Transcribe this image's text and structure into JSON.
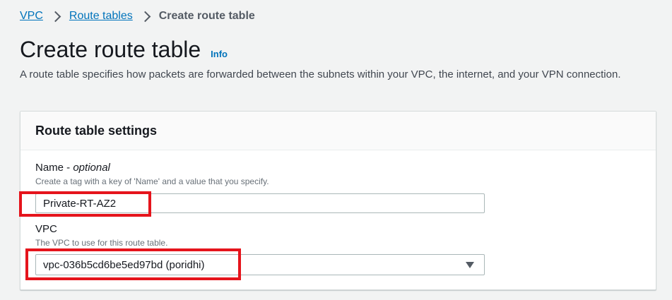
{
  "breadcrumb": {
    "items": [
      {
        "label": "VPC"
      },
      {
        "label": "Route tables"
      }
    ],
    "current": "Create route table"
  },
  "header": {
    "title": "Create route table",
    "info_label": "Info",
    "description": "A route table specifies how packets are forwarded between the subnets within your VPC, the internet, and your VPN connection."
  },
  "settings": {
    "title": "Route table settings",
    "name_field": {
      "label": "Name - ",
      "label_optional": "optional",
      "description": "Create a tag with a key of 'Name' and a value that you specify.",
      "value": "Private-RT-AZ2"
    },
    "vpc_field": {
      "label": "VPC",
      "description": "The VPC to use for this route table.",
      "selected": "vpc-036b5cd6be5ed97bd (poridhi)"
    }
  },
  "colors": {
    "link": "#0073bb",
    "highlight": "#e5141c",
    "background": "#f2f3f3"
  }
}
